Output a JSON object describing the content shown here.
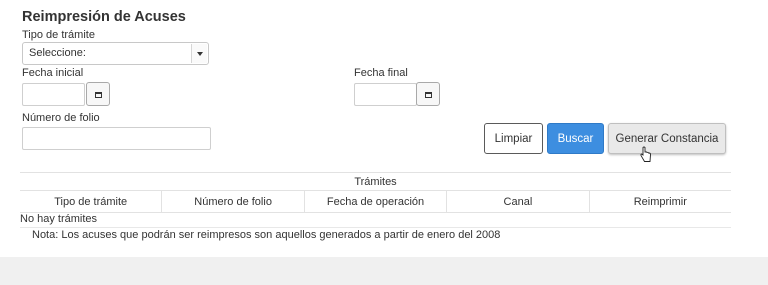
{
  "page": {
    "title": "Reimpresión de Acuses"
  },
  "form": {
    "tipo_tramite_label": "Tipo de trámite",
    "tipo_tramite_value": "Seleccione:",
    "fecha_inicial_label": "Fecha inicial",
    "fecha_final_label": "Fecha final",
    "numero_folio_label": "Número de folio",
    "fecha_inicial_value": "",
    "fecha_final_value": "",
    "numero_folio_value": ""
  },
  "actions": {
    "limpiar": "Limpiar",
    "buscar": "Buscar",
    "generar": "Generar Constancia"
  },
  "table": {
    "title": "Trámites",
    "columns": [
      "Tipo de trámite",
      "Número de folio",
      "Fecha de operación",
      "Canal",
      "Reimprimir"
    ],
    "empty_message": "No hay trámites"
  },
  "note": "Nota: Los acuses que podrán ser reimpresos son aquellos generados a partir de enero del 2008",
  "colors": {
    "primary_button": "#3d8ee0",
    "secondary_button": "#e9e9e9"
  },
  "icons": {
    "calendar": "calendar-icon",
    "dropdown": "chevron-down-icon",
    "cursor": "hand-pointer-icon"
  }
}
